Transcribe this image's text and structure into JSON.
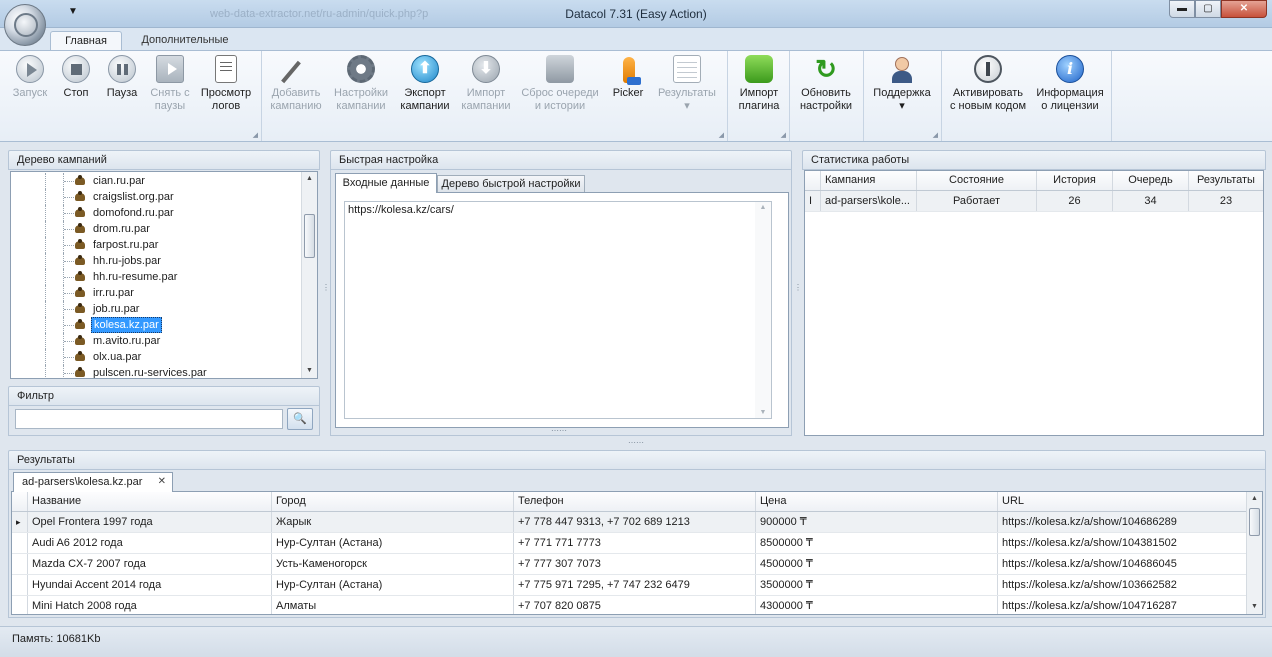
{
  "window": {
    "title": "Datacol 7.31 (Easy Action)",
    "url_ghost": "web-data-extractor.net/ru-admin/quick.php?p",
    "min_glyph": "▬",
    "max_glyph": "▢",
    "close_glyph": "✕",
    "qat_glyph": "▼"
  },
  "ribbon": {
    "tabs": [
      "Главная",
      "Дополнительные"
    ],
    "buttons": {
      "start": [
        "Запуск",
        ""
      ],
      "stop": [
        "Стоп",
        ""
      ],
      "pause": [
        "Пауза",
        ""
      ],
      "unpause": [
        "Снять с",
        "паузы"
      ],
      "logs": [
        "Просмотр",
        "логов"
      ],
      "add_campaign": [
        "Добавить",
        "кампанию"
      ],
      "campaign_settings": [
        "Настройки",
        "кампании"
      ],
      "export": [
        "Экспорт",
        "кампании"
      ],
      "import": [
        "Импорт",
        "кампании"
      ],
      "reset_queue": [
        "Сброс очереди",
        "и истории"
      ],
      "picker": [
        "Picker",
        ""
      ],
      "results": [
        "Результаты",
        "▾"
      ],
      "import_plugin": [
        "Импорт",
        "плагина"
      ],
      "update_settings": [
        "Обновить",
        "настройки"
      ],
      "support": [
        "Поддержка",
        "▾"
      ],
      "activate": [
        "Активировать",
        "с новым кодом"
      ],
      "license_info": [
        "Информация",
        "о лицензии"
      ]
    }
  },
  "campaign_tree": {
    "title": "Дерево кампаний",
    "items": [
      "cian.ru.par",
      "craigslist.org.par",
      "domofond.ru.par",
      "drom.ru.par",
      "farpost.ru.par",
      "hh.ru-jobs.par",
      "hh.ru-resume.par",
      "irr.ru.par",
      "job.ru.par",
      "kolesa.kz.par",
      "m.avito.ru.par",
      "olx.ua.par",
      "pulscen.ru-services.par"
    ],
    "selected_index": 9
  },
  "filter": {
    "title": "Фильтр",
    "value": "",
    "search_glyph": "🔍"
  },
  "quick_setup": {
    "title": "Быстрая настройка",
    "tabs": [
      "Входные данные",
      "Дерево быстрой настройки"
    ],
    "input_text": "https://kolesa.kz/cars/"
  },
  "stats": {
    "title": "Статистика работы",
    "columns": [
      "Кампания",
      "Состояние",
      "История",
      "Очередь",
      "Результаты"
    ],
    "row_marker": "I",
    "rows": [
      [
        "ad-parsers\\kole...",
        "Работает",
        "26",
        "34",
        "23"
      ]
    ]
  },
  "results": {
    "title": "Результаты",
    "tab_label": "ad-parsers\\kolesa.kz.par",
    "tab_close": "✕",
    "row_marker": "▸",
    "columns": [
      "Название",
      "Город",
      "Телефон",
      "Цена",
      "URL"
    ],
    "rows": [
      [
        "Opel Frontera 1997 года",
        "Жарык",
        "+7 778 447 9313, +7 702 689 1213",
        "900000 ₸",
        "https://kolesa.kz/a/show/104686289"
      ],
      [
        "Audi A6 2012 года",
        "Нур-Султан (Астана)",
        "+7 771 771 7773",
        "8500000 ₸",
        "https://kolesa.kz/a/show/104381502"
      ],
      [
        "Mazda CX-7 2007 года",
        "Усть-Каменогорск",
        "+7 777 307 7073",
        "4500000 ₸",
        "https://kolesa.kz/a/show/104686045"
      ],
      [
        "Hyundai Accent 2014 года",
        "Нур-Султан (Астана)",
        "+7 775 971 7295, +7 747 232 6479",
        "3500000 ₸",
        "https://kolesa.kz/a/show/103662582"
      ],
      [
        "Mini Hatch 2008 года",
        "Алматы",
        "+7 707 820 0875",
        "4300000 ₸",
        "https://kolesa.kz/a/show/104716287"
      ]
    ]
  },
  "statusbar": {
    "memory": "Память: 10681Kb"
  },
  "colors": {
    "accent": "#3399ff",
    "ribbon_bg": "#e7eef6",
    "window_bg": "#dfe6ee"
  }
}
